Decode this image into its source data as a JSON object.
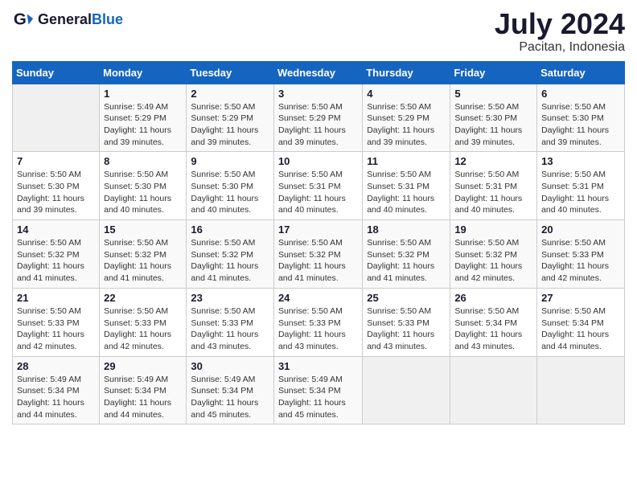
{
  "header": {
    "logo_general": "General",
    "logo_blue": "Blue",
    "title": "July 2024",
    "subtitle": "Pacitan, Indonesia"
  },
  "calendar": {
    "days_of_week": [
      "Sunday",
      "Monday",
      "Tuesday",
      "Wednesday",
      "Thursday",
      "Friday",
      "Saturday"
    ],
    "weeks": [
      [
        {
          "day": "",
          "info": ""
        },
        {
          "day": "1",
          "info": "Sunrise: 5:49 AM\nSunset: 5:29 PM\nDaylight: 11 hours\nand 39 minutes."
        },
        {
          "day": "2",
          "info": "Sunrise: 5:50 AM\nSunset: 5:29 PM\nDaylight: 11 hours\nand 39 minutes."
        },
        {
          "day": "3",
          "info": "Sunrise: 5:50 AM\nSunset: 5:29 PM\nDaylight: 11 hours\nand 39 minutes."
        },
        {
          "day": "4",
          "info": "Sunrise: 5:50 AM\nSunset: 5:29 PM\nDaylight: 11 hours\nand 39 minutes."
        },
        {
          "day": "5",
          "info": "Sunrise: 5:50 AM\nSunset: 5:30 PM\nDaylight: 11 hours\nand 39 minutes."
        },
        {
          "day": "6",
          "info": "Sunrise: 5:50 AM\nSunset: 5:30 PM\nDaylight: 11 hours\nand 39 minutes."
        }
      ],
      [
        {
          "day": "7",
          "info": "Sunrise: 5:50 AM\nSunset: 5:30 PM\nDaylight: 11 hours\nand 39 minutes."
        },
        {
          "day": "8",
          "info": "Sunrise: 5:50 AM\nSunset: 5:30 PM\nDaylight: 11 hours\nand 40 minutes."
        },
        {
          "day": "9",
          "info": "Sunrise: 5:50 AM\nSunset: 5:30 PM\nDaylight: 11 hours\nand 40 minutes."
        },
        {
          "day": "10",
          "info": "Sunrise: 5:50 AM\nSunset: 5:31 PM\nDaylight: 11 hours\nand 40 minutes."
        },
        {
          "day": "11",
          "info": "Sunrise: 5:50 AM\nSunset: 5:31 PM\nDaylight: 11 hours\nand 40 minutes."
        },
        {
          "day": "12",
          "info": "Sunrise: 5:50 AM\nSunset: 5:31 PM\nDaylight: 11 hours\nand 40 minutes."
        },
        {
          "day": "13",
          "info": "Sunrise: 5:50 AM\nSunset: 5:31 PM\nDaylight: 11 hours\nand 40 minutes."
        }
      ],
      [
        {
          "day": "14",
          "info": "Sunrise: 5:50 AM\nSunset: 5:32 PM\nDaylight: 11 hours\nand 41 minutes."
        },
        {
          "day": "15",
          "info": "Sunrise: 5:50 AM\nSunset: 5:32 PM\nDaylight: 11 hours\nand 41 minutes."
        },
        {
          "day": "16",
          "info": "Sunrise: 5:50 AM\nSunset: 5:32 PM\nDaylight: 11 hours\nand 41 minutes."
        },
        {
          "day": "17",
          "info": "Sunrise: 5:50 AM\nSunset: 5:32 PM\nDaylight: 11 hours\nand 41 minutes."
        },
        {
          "day": "18",
          "info": "Sunrise: 5:50 AM\nSunset: 5:32 PM\nDaylight: 11 hours\nand 41 minutes."
        },
        {
          "day": "19",
          "info": "Sunrise: 5:50 AM\nSunset: 5:32 PM\nDaylight: 11 hours\nand 42 minutes."
        },
        {
          "day": "20",
          "info": "Sunrise: 5:50 AM\nSunset: 5:33 PM\nDaylight: 11 hours\nand 42 minutes."
        }
      ],
      [
        {
          "day": "21",
          "info": "Sunrise: 5:50 AM\nSunset: 5:33 PM\nDaylight: 11 hours\nand 42 minutes."
        },
        {
          "day": "22",
          "info": "Sunrise: 5:50 AM\nSunset: 5:33 PM\nDaylight: 11 hours\nand 42 minutes."
        },
        {
          "day": "23",
          "info": "Sunrise: 5:50 AM\nSunset: 5:33 PM\nDaylight: 11 hours\nand 43 minutes."
        },
        {
          "day": "24",
          "info": "Sunrise: 5:50 AM\nSunset: 5:33 PM\nDaylight: 11 hours\nand 43 minutes."
        },
        {
          "day": "25",
          "info": "Sunrise: 5:50 AM\nSunset: 5:33 PM\nDaylight: 11 hours\nand 43 minutes."
        },
        {
          "day": "26",
          "info": "Sunrise: 5:50 AM\nSunset: 5:34 PM\nDaylight: 11 hours\nand 43 minutes."
        },
        {
          "day": "27",
          "info": "Sunrise: 5:50 AM\nSunset: 5:34 PM\nDaylight: 11 hours\nand 44 minutes."
        }
      ],
      [
        {
          "day": "28",
          "info": "Sunrise: 5:49 AM\nSunset: 5:34 PM\nDaylight: 11 hours\nand 44 minutes."
        },
        {
          "day": "29",
          "info": "Sunrise: 5:49 AM\nSunset: 5:34 PM\nDaylight: 11 hours\nand 44 minutes."
        },
        {
          "day": "30",
          "info": "Sunrise: 5:49 AM\nSunset: 5:34 PM\nDaylight: 11 hours\nand 45 minutes."
        },
        {
          "day": "31",
          "info": "Sunrise: 5:49 AM\nSunset: 5:34 PM\nDaylight: 11 hours\nand 45 minutes."
        },
        {
          "day": "",
          "info": ""
        },
        {
          "day": "",
          "info": ""
        },
        {
          "day": "",
          "info": ""
        }
      ]
    ]
  }
}
